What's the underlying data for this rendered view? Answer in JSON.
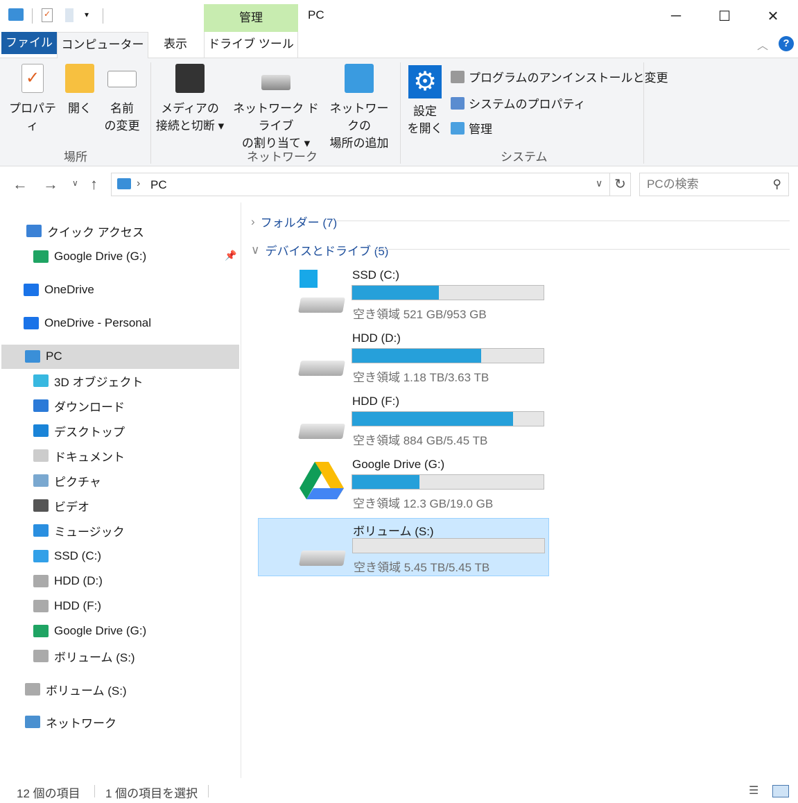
{
  "window": {
    "title": "PC",
    "context_tab": "管理",
    "minimize": "─",
    "maximize": "☐",
    "close": "✕"
  },
  "tabs": {
    "file": "ファイル",
    "computer": "コンピューター",
    "view": "表示",
    "drive_tools": "ドライブ ツール"
  },
  "ribbon": {
    "location": {
      "label": "場所",
      "properties": "プロパティ",
      "open": "開く",
      "rename_1": "名前",
      "rename_2": "の変更"
    },
    "network": {
      "label": "ネットワーク",
      "media_1": "メディアの",
      "media_2": "接続と切断",
      "map_1": "ネットワーク ドライブ",
      "map_2": "の割り当て",
      "add_1": "ネットワークの",
      "add_2": "場所の追加"
    },
    "system": {
      "label": "システム",
      "settings_1": "設定",
      "settings_2": "を開く",
      "uninstall": "プログラムのアンインストールと変更",
      "sysprops": "システムのプロパティ",
      "manage": "管理"
    }
  },
  "nav": {
    "path": "PC",
    "search_placeholder": "PCの検索"
  },
  "sidebar": {
    "items": [
      {
        "label": "クイック アクセス"
      },
      {
        "label": "Google Drive (G:)"
      },
      {
        "label": "OneDrive"
      },
      {
        "label": "OneDrive - Personal"
      },
      {
        "label": "PC"
      },
      {
        "label": "3D オブジェクト"
      },
      {
        "label": "ダウンロード"
      },
      {
        "label": "デスクトップ"
      },
      {
        "label": "ドキュメント"
      },
      {
        "label": "ピクチャ"
      },
      {
        "label": "ビデオ"
      },
      {
        "label": "ミュージック"
      },
      {
        "label": "SSD (C:)"
      },
      {
        "label": "HDD (D:)"
      },
      {
        "label": "HDD (F:)"
      },
      {
        "label": "Google Drive (G:)"
      },
      {
        "label": "ボリューム (S:)"
      },
      {
        "label": "ボリューム (S:)"
      },
      {
        "label": "ネットワーク"
      }
    ]
  },
  "groups": {
    "folders": "フォルダー (7)",
    "devices": "デバイスとドライブ (5)"
  },
  "drives": [
    {
      "name": "SSD (C:)",
      "free": "空き領域 521 GB/953 GB",
      "used_percent": 45.3,
      "icon": "windows-drive"
    },
    {
      "name": "HDD (D:)",
      "free": "空き領域 1.18 TB/3.63 TB",
      "used_percent": 67.5,
      "icon": "hdd"
    },
    {
      "name": "HDD (F:)",
      "free": "空き領域 884 GB/5.45 TB",
      "used_percent": 84.2,
      "icon": "hdd"
    },
    {
      "name": "Google Drive (G:)",
      "free": "空き領域 12.3 GB/19.0 GB",
      "used_percent": 35.3,
      "icon": "google-drive"
    },
    {
      "name": "ボリューム (S:)",
      "free": "空き領域 5.45 TB/5.45 TB",
      "used_percent": 0,
      "icon": "hdd"
    }
  ],
  "status": {
    "count": "12 個の項目",
    "selected": "1 個の項目を選択"
  }
}
